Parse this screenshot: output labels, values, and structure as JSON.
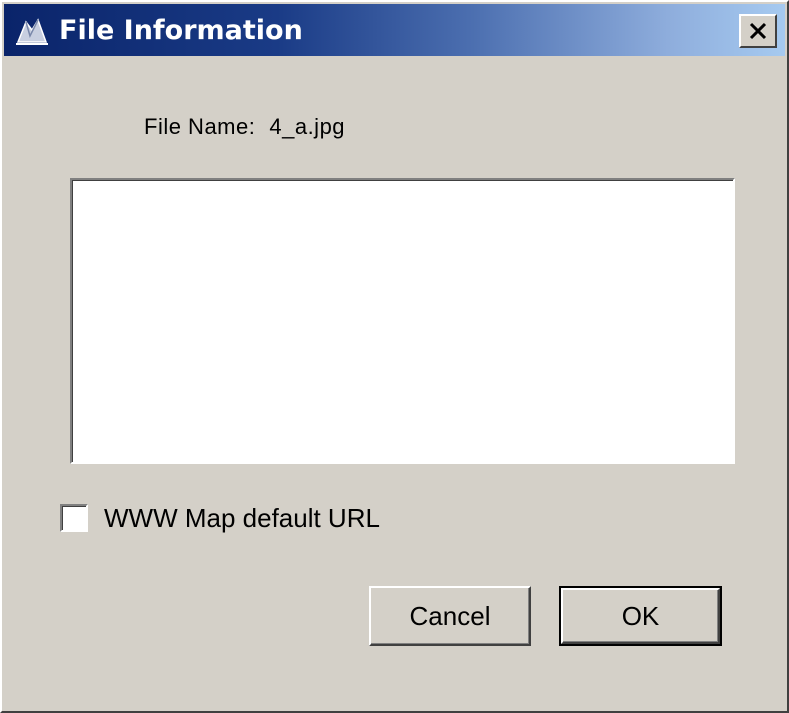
{
  "window": {
    "title": "File Information",
    "title_icon": "app-icon",
    "close_icon": "close-icon"
  },
  "file": {
    "label": "File Name:",
    "value": "4_a.jpg"
  },
  "info_text": {
    "value": ""
  },
  "checkbox": {
    "label": "WWW Map default URL",
    "checked": false
  },
  "buttons": {
    "cancel_label": "Cancel",
    "ok_label": "OK"
  },
  "colors": {
    "title_start": "#0a246a",
    "title_end": "#a6caf0",
    "dialog_bg": "#d4d0c8"
  }
}
